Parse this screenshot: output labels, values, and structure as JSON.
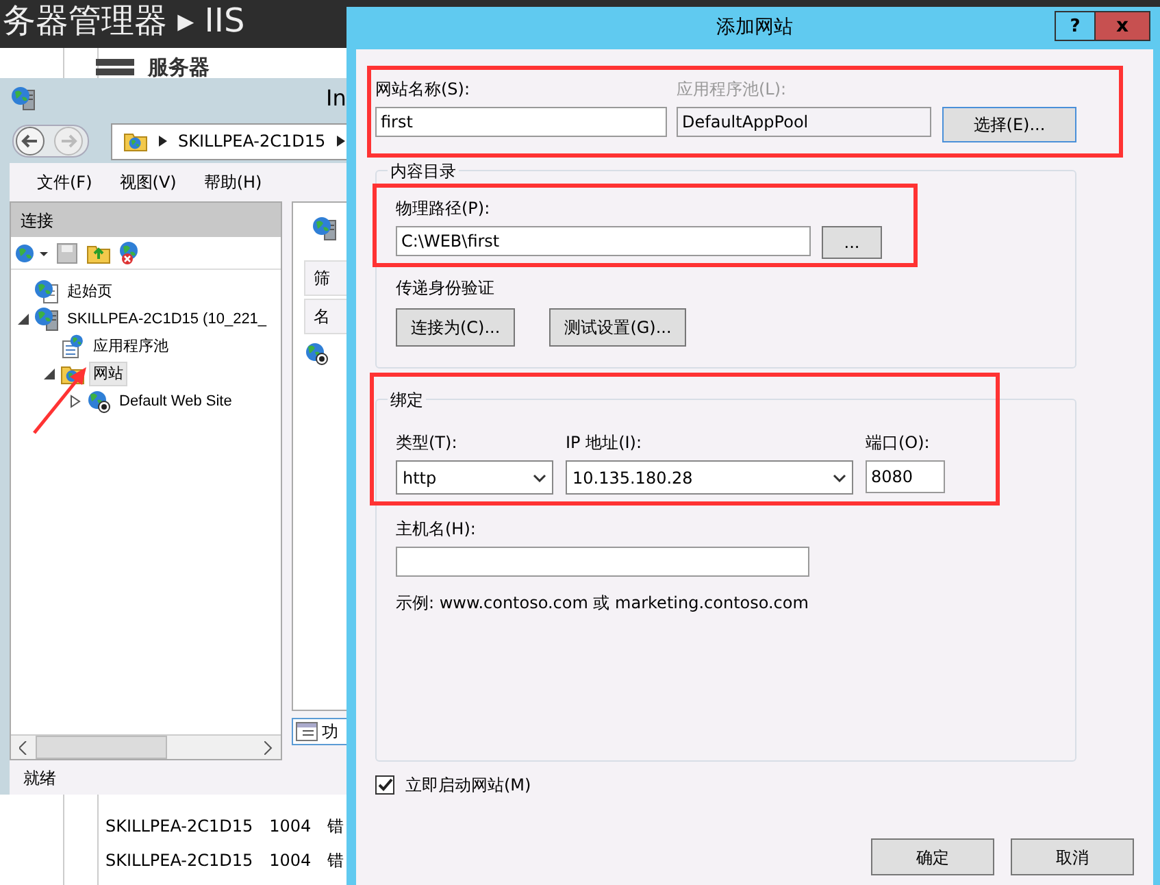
{
  "background_window": {
    "title": "务器管理器 ▸ IIS",
    "section": "服务器",
    "rows": [
      {
        "server": "SKILLPEA-2C1D15",
        "id": "1004",
        "type": "错"
      },
      {
        "server": "SKILLPEA-2C1D15",
        "id": "1004",
        "type": "错"
      }
    ]
  },
  "iis_window": {
    "title": "In",
    "address": "SKILLPEA-2C1D15",
    "menu": [
      "文件(F)",
      "视图(V)",
      "帮助(H)"
    ],
    "connections": {
      "header": "连接",
      "tree": [
        {
          "label": "起始页",
          "kind": "start",
          "selected": false
        },
        {
          "label": "SKILLPEA-2C1D15 (10_221_",
          "kind": "server",
          "selected": false,
          "expanded": true,
          "children": [
            {
              "label": "应用程序池",
              "kind": "pool",
              "selected": false
            },
            {
              "label": "网站",
              "kind": "sites",
              "selected": true,
              "expanded": true,
              "children": [
                {
                  "label": "Default Web Site",
                  "kind": "site",
                  "selected": false,
                  "expanded": false
                }
              ]
            }
          ]
        }
      ]
    },
    "content": {
      "filter_label": "筛",
      "column": "名",
      "tab": "功"
    },
    "status": "就绪"
  },
  "dialog": {
    "title": "添加网站",
    "help": "?",
    "close": "x",
    "site_name": {
      "label": "网站名称(S):",
      "value": "first"
    },
    "app_pool": {
      "label": "应用程序池(L):",
      "value": "DefaultAppPool",
      "disabled": true
    },
    "select_button": "选择(E)...",
    "content_directory": {
      "legend": "内容目录",
      "path_label": "物理路径(P):",
      "path_value": "C:\\WEB\\first",
      "browse_button": "...",
      "auth_label": "传递身份验证",
      "buttons": [
        "连接为(C)...",
        "测试设置(G)..."
      ]
    },
    "binding": {
      "legend": "绑定",
      "type_label": "类型(T):",
      "type_value": "http",
      "ip_label": "IP 地址(I):",
      "ip_value": "10.135.180.28",
      "port_label": "端口(O):",
      "port_value": "8080",
      "host_label": "主机名(H):",
      "example": "示例: www.contoso.com 或 marketing.contoso.com"
    },
    "start_now": {
      "label": "立即启动网站(M)",
      "checked": true
    },
    "buttons": [
      "确定",
      "取消"
    ]
  },
  "annotations": [
    {
      "kind": "frame"
    },
    {
      "kind": "frame"
    },
    {
      "kind": "frame"
    },
    {
      "kind": "arrow"
    }
  ]
}
